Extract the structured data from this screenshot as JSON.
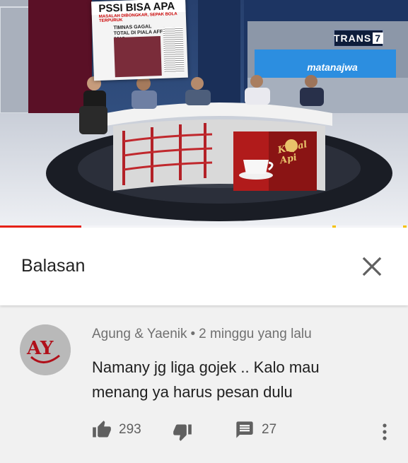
{
  "video": {
    "broadcaster_logo": {
      "prefix": "TRANS",
      "number": "7"
    },
    "studio_sign": "matanajwa",
    "newspaper": {
      "headline": "PSSI BISA APA",
      "subheadline": "MASALAH DIBONGKAR, SEPAK BOLA TERPURUK",
      "story_title": "TIMNAS GAGAL TOTAL DI PIALA AFF 2018"
    },
    "sponsor_poster": {
      "brand": "Kapal Api"
    },
    "playback_progress_percent": 20,
    "colors": {
      "progress": "#e62117",
      "ad_marker": "#f6c200"
    }
  },
  "sheet": {
    "title": "Balasan",
    "close_icon": "close-icon"
  },
  "comment": {
    "avatar_initials": "AY",
    "author": "Agung & Yaenik",
    "separator": "•",
    "time": "2 minggu yang lalu",
    "text_line1": "Namany jg liga gojek .. Kalo mau",
    "text_line2": "menang ya harus pesan dulu",
    "like_count": "293",
    "reply_count": "27",
    "icons": {
      "like": "thumbs-up-icon",
      "dislike": "thumbs-down-icon",
      "reply": "reply-icon",
      "more": "more-vertical-icon"
    }
  }
}
